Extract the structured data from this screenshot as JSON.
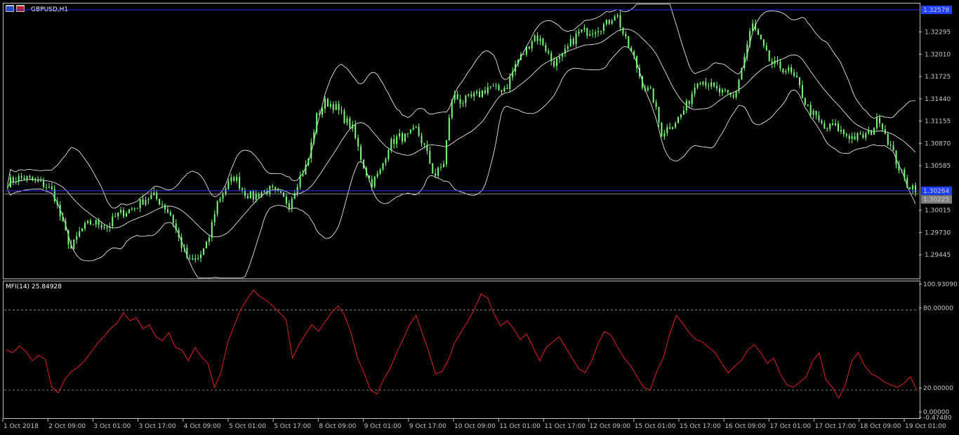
{
  "window": {
    "title": "GBPUSD,H1"
  },
  "colors": {
    "background": "#000000",
    "frame": "#c0c0c0",
    "candle": "#7CFC7C",
    "bands": "#ffffff",
    "mfi_line": "#e02020",
    "level_line": "#3030ff",
    "ask_bg": "#2040ff",
    "bid_bg": "#808080"
  },
  "price_panel": {
    "price_labels": [
      "1.32295",
      "1.32010",
      "1.31725",
      "1.31440",
      "1.31155",
      "1.30870",
      "1.30585",
      "1.30015",
      "1.29730",
      "1.29445"
    ],
    "ask_label": "1.32578",
    "bid_label": "1.30264",
    "current_label": "1.30225"
  },
  "indicator_panel": {
    "title": "MFI(14) 25.84928",
    "scale_labels": [
      "100.93090",
      "80.00000",
      "20.00000",
      "0.00000",
      "-0.47480"
    ]
  },
  "time_axis": {
    "labels": [
      "1 Oct 2018",
      "2 Oct 09:00",
      "3 Oct 01:00",
      "3 Oct 17:00",
      "4 Oct 09:00",
      "5 Oct 01:00",
      "5 Oct 17:00",
      "8 Oct 09:00",
      "9 Oct 01:00",
      "9 Oct 17:00",
      "10 Oct 09:00",
      "11 Oct 01:00",
      "11 Oct 17:00",
      "12 Oct 09:00",
      "15 Oct 01:00",
      "15 Oct 17:00",
      "16 Oct 09:00",
      "17 Oct 01:00",
      "17 Oct 17:00",
      "18 Oct 09:00",
      "19 Oct 01:00"
    ]
  },
  "chart_data": [
    {
      "type": "candlestick",
      "title": "GBPUSD,H1",
      "ylim": [
        1.2915,
        1.3265
      ],
      "price_path": [
        1.3037,
        1.3042,
        1.3043,
        1.3038,
        1.3034,
        1.3025,
        1.2985,
        1.2952,
        1.2975,
        1.2985,
        1.2985,
        1.298,
        1.2995,
        1.3,
        1.3005,
        1.3015,
        1.302,
        1.301,
        1.2995,
        1.296,
        1.2935,
        1.294,
        1.2958,
        1.301,
        1.303,
        1.3045,
        1.3025,
        1.3018,
        1.3025,
        1.3028,
        1.302,
        1.301,
        1.304,
        1.306,
        1.312,
        1.314,
        1.3135,
        1.312,
        1.3105,
        1.3065,
        1.3035,
        1.305,
        1.3085,
        1.3095,
        1.3095,
        1.3105,
        1.308,
        1.3045,
        1.306,
        1.315,
        1.314,
        1.3145,
        1.315,
        1.316,
        1.3155,
        1.316,
        1.319,
        1.3205,
        1.3225,
        1.3215,
        1.319,
        1.3195,
        1.3215,
        1.323,
        1.323,
        1.3235,
        1.324,
        1.3255,
        1.322,
        1.3195,
        1.316,
        1.315,
        1.31,
        1.311,
        1.312,
        1.314,
        1.317,
        1.3165,
        1.3155,
        1.315,
        1.3145,
        1.319,
        1.324,
        1.3215,
        1.319,
        1.3185,
        1.318,
        1.3165,
        1.3135,
        1.312,
        1.3105,
        1.311,
        1.31,
        1.3095,
        1.3095,
        1.31,
        1.312,
        1.309,
        1.306,
        1.3035,
        1.303
      ]
    },
    {
      "type": "line",
      "title": "MFI(14) 25.84928",
      "ylim": [
        -0.4748,
        100.9309
      ],
      "levels": [
        80,
        20
      ],
      "values": [
        50,
        48,
        53,
        49,
        42,
        46,
        43,
        22,
        18,
        28,
        34,
        37,
        42,
        48,
        55,
        60,
        66,
        70,
        78,
        72,
        74,
        66,
        69,
        60,
        57,
        63,
        52,
        50,
        42,
        52,
        45,
        40,
        22,
        33,
        55,
        68,
        80,
        88,
        95,
        90,
        87,
        83,
        78,
        73,
        44,
        54,
        62,
        69,
        64,
        71,
        78,
        83,
        76,
        63,
        44,
        33,
        20,
        17,
        28,
        36,
        48,
        58,
        69,
        76,
        62,
        48,
        32,
        34,
        43,
        56,
        64,
        72,
        81,
        92,
        89,
        77,
        68,
        72,
        66,
        58,
        62,
        52,
        42,
        52,
        56,
        60,
        52,
        44,
        36,
        33,
        42,
        55,
        64,
        61,
        52,
        44,
        38,
        30,
        22,
        20,
        34,
        44,
        62,
        76,
        70,
        63,
        58,
        56,
        52,
        48,
        40,
        33,
        38,
        42,
        50,
        54,
        48,
        40,
        44,
        32,
        24,
        22,
        26,
        30,
        42,
        48,
        28,
        22,
        14,
        24,
        42,
        48,
        38,
        32,
        30,
        26,
        24,
        22,
        25,
        30,
        20
      ]
    }
  ]
}
